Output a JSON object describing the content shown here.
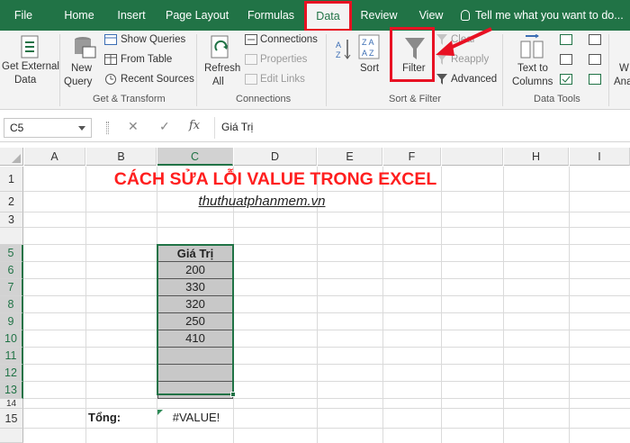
{
  "tabs": [
    {
      "label": "File",
      "active": false
    },
    {
      "label": "Home",
      "active": false
    },
    {
      "label": "Insert",
      "active": false
    },
    {
      "label": "Page Layout",
      "active": false
    },
    {
      "label": "Formulas",
      "active": false
    },
    {
      "label": "Data",
      "active": true
    },
    {
      "label": "Review",
      "active": false
    },
    {
      "label": "View",
      "active": false
    }
  ],
  "tell_me": "Tell me what you want to do...",
  "ribbon": {
    "get_external_line1": "Get External",
    "get_external_line2": "Data",
    "new_query_line1": "New",
    "new_query_line2": "Query",
    "show_queries": "Show Queries",
    "from_table": "From Table",
    "recent_sources": "Recent Sources",
    "group_get_transform": "Get & Transform",
    "refresh_line1": "Refresh",
    "refresh_line2": "All",
    "connections": "Connections",
    "properties": "Properties",
    "edit_links": "Edit Links",
    "group_connections": "Connections",
    "sort": "Sort",
    "filter": "Filter",
    "clear": "Clear",
    "reapply": "Reapply",
    "advanced": "Advanced",
    "group_sort_filter": "Sort & Filter",
    "text_to_columns_line1": "Text to",
    "text_to_columns_line2": "Columns",
    "group_data_tools": "Data Tools",
    "partial_what_if_1": "W",
    "partial_what_if_2": "Ana"
  },
  "formula_bar": {
    "name_box": "C5",
    "cancel_symbol": "✕",
    "enter_symbol": "✓",
    "fx_symbol": "fx",
    "formula": "Giá Trị"
  },
  "columns": [
    "A",
    "B",
    "C",
    "D",
    "E",
    "F",
    "H",
    "I"
  ],
  "rows": [
    "1",
    "2",
    "3",
    "5",
    "6",
    "7",
    "8",
    "9",
    "10",
    "11",
    "12",
    "13",
    "14",
    "15"
  ],
  "sheet": {
    "title": "CÁCH SỬA LỖI VALUE TRONG EXCEL",
    "subtitle": "thuthuatphanmem.vn",
    "table_header": "Giá Trị",
    "values": [
      "200",
      "330",
      "320",
      "250",
      "410",
      "",
      "",
      ""
    ],
    "total_label": "Tổng:",
    "total_value": "#VALUE!"
  },
  "colors": {
    "excel_green": "#217346",
    "highlight_red": "#e81123",
    "title_red": "#ff1f1f",
    "table_fill": "#c8c8c8"
  }
}
